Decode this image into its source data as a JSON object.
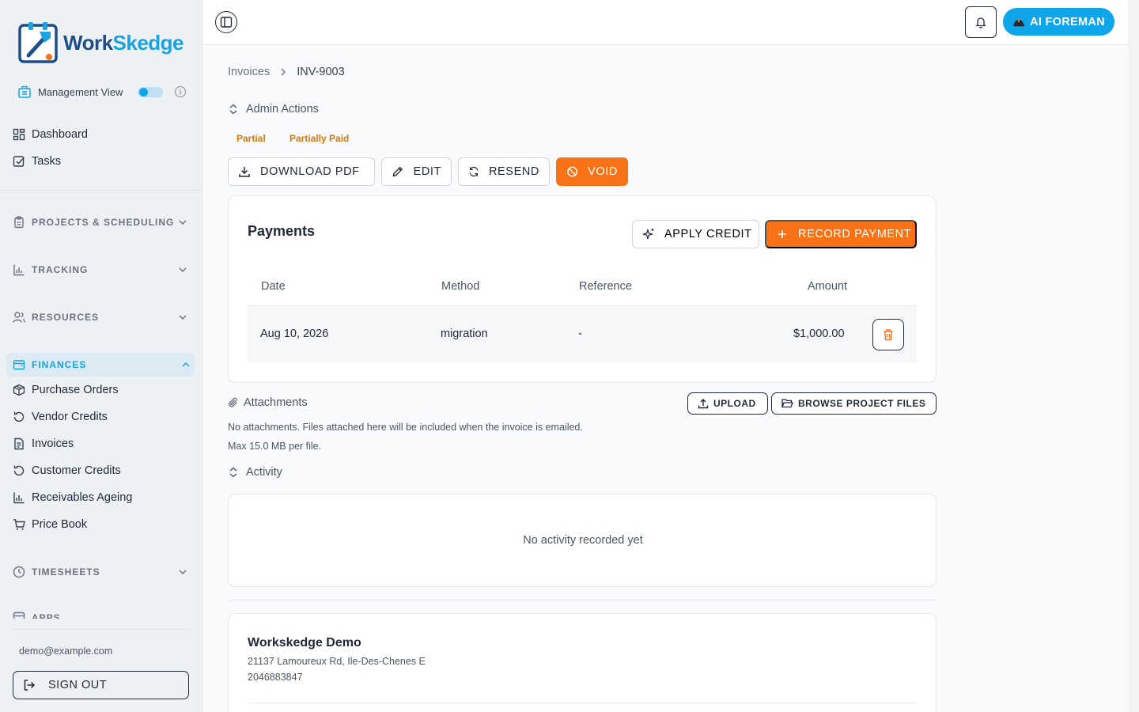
{
  "brand": {
    "name_part1": "Work",
    "name_part2": "Skedge",
    "primary": "#1d4e89",
    "accent": "#1aa3e0"
  },
  "sidebar": {
    "management_view_label": "Management View",
    "management_view_on": true,
    "top_items": [
      {
        "label": "Dashboard",
        "icon": "dashboard-icon"
      },
      {
        "label": "Tasks",
        "icon": "tasks-icon"
      }
    ],
    "sections": [
      {
        "label": "PROJECTS & SCHEDULING",
        "icon": "clipboard-icon",
        "expanded": false
      },
      {
        "label": "TRACKING",
        "icon": "bar-chart-icon",
        "expanded": false
      },
      {
        "label": "RESOURCES",
        "icon": "users-icon",
        "expanded": false
      },
      {
        "label": "FINANCES",
        "icon": "wallet-icon",
        "expanded": true
      },
      {
        "label": "TIMESHEETS",
        "icon": "clock-icon",
        "expanded": false
      },
      {
        "label": "APPS",
        "icon": "apps-icon",
        "expanded": false
      }
    ],
    "finance_items": [
      {
        "label": "Purchase Orders",
        "icon": "package-icon"
      },
      {
        "label": "Vendor Credits",
        "icon": "rotate-icon"
      },
      {
        "label": "Invoices",
        "icon": "document-icon"
      },
      {
        "label": "Customer Credits",
        "icon": "rotate-icon"
      },
      {
        "label": "Receivables Ageing",
        "icon": "bar-chart-icon"
      },
      {
        "label": "Price Book",
        "icon": "cart-icon"
      }
    ],
    "user_email": "demo@example.com",
    "sign_out_label": "SIGN OUT"
  },
  "topbar": {
    "ai_button_label": "AI FOREMAN"
  },
  "breadcrumb": {
    "parent": "Invoices",
    "current": "INV-9003"
  },
  "admin_actions": {
    "label": "Admin Actions",
    "badges": [
      "Partial",
      "Partially Paid"
    ],
    "buttons": {
      "download": "DOWNLOAD PDF",
      "edit": "EDIT",
      "resend": "RESEND",
      "void": "VOID"
    }
  },
  "payments": {
    "title": "Payments",
    "apply_credit_label": "APPLY CREDIT",
    "record_payment_label": "RECORD PAYMENT",
    "columns": [
      "Date",
      "Method",
      "Reference",
      "Amount"
    ],
    "rows": [
      {
        "date": "Aug 10, 2026",
        "method": "migration",
        "reference": "-",
        "amount": "$1,000.00"
      }
    ]
  },
  "attachments": {
    "label": "Attachments",
    "upload_label": "UPLOAD",
    "browse_label": "BROWSE PROJECT FILES",
    "empty_text": "No attachments. Files attached here will be included when the invoice is emailed.",
    "max_size_text": "Max 15.0 MB per file."
  },
  "activity": {
    "label": "Activity",
    "empty_text": "No activity recorded yet"
  },
  "company": {
    "name": "Workskedge Demo",
    "address": "21137 Lamoureux Rd, Ile-Des-Chenes E",
    "phone": "2046883847"
  },
  "colors": {
    "orange": "#f97316",
    "sky": "#0ea5e9",
    "badge_amber": "#d97706"
  }
}
